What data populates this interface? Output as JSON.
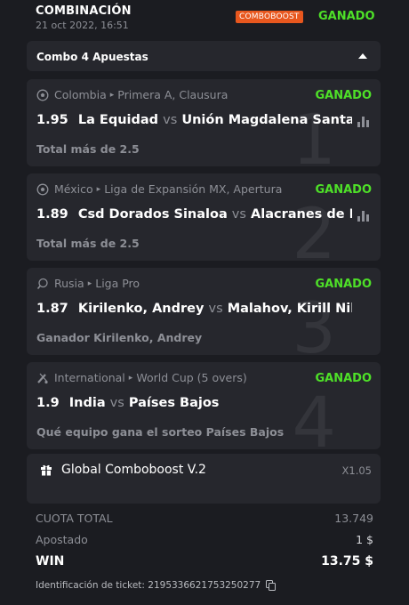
{
  "header": {
    "title": "COMBINACIÓN",
    "datetime": "21 oct 2022, 16:51",
    "badge": "COMBOBOOST",
    "status": "GANADO"
  },
  "combo": {
    "label": "Combo 4 Apuestas"
  },
  "bets": [
    {
      "index": "1",
      "icon": "soccer-ball-icon",
      "country": "Colombia",
      "league": "Primera A, Clausura",
      "status": "GANADO",
      "odd": "1.95",
      "home": "La Equidad",
      "vs": "vs",
      "away": "Unión Magdalena Santa",
      "selection": "Total más de 2.5"
    },
    {
      "index": "2",
      "icon": "soccer-ball-icon",
      "country": "México",
      "league": "Liga de Expansión MX, Apertura",
      "status": "GANADO",
      "odd": "1.89",
      "home": "Csd Dorados Sinaloa",
      "vs": "vs",
      "away": "Alacranes de Du",
      "selection": "Total más de 2.5"
    },
    {
      "index": "3",
      "icon": "table-tennis-icon",
      "country": "Rusia",
      "league": "Liga Pro",
      "status": "GANADO",
      "odd": "1.87",
      "home": "Kirilenko, Andrey",
      "vs": "vs",
      "away": "Malahov, Kirill Nikolaev",
      "selection": "Ganador Kirilenko, Andrey"
    },
    {
      "index": "4",
      "icon": "cricket-icon",
      "country": "International",
      "league": "World Cup (5 overs)",
      "status": "GANADO",
      "odd": "1.9",
      "home": "India",
      "vs": "vs",
      "away": "Países Bajos",
      "selection": "Qué equipo gana el sorteo Países Bajos"
    }
  ],
  "boost": {
    "icon": "gift-icon",
    "name": "Global Comboboost V.2",
    "value": "X1.05"
  },
  "summary": {
    "total_label": "CUOTA TOTAL",
    "total_value": "13.749",
    "staked_label": "Apostado",
    "staked_value": "1 $",
    "win_label": "WIN",
    "win_value": "13.75 $"
  },
  "ticket": {
    "label": "Identificación de ticket:",
    "id": "2195336621753250277"
  },
  "colors": {
    "background": "#1b1c21",
    "card": "#26272d",
    "win_green": "#4ee028",
    "badge_orange": "#e8571e",
    "muted": "#8d8f96"
  }
}
